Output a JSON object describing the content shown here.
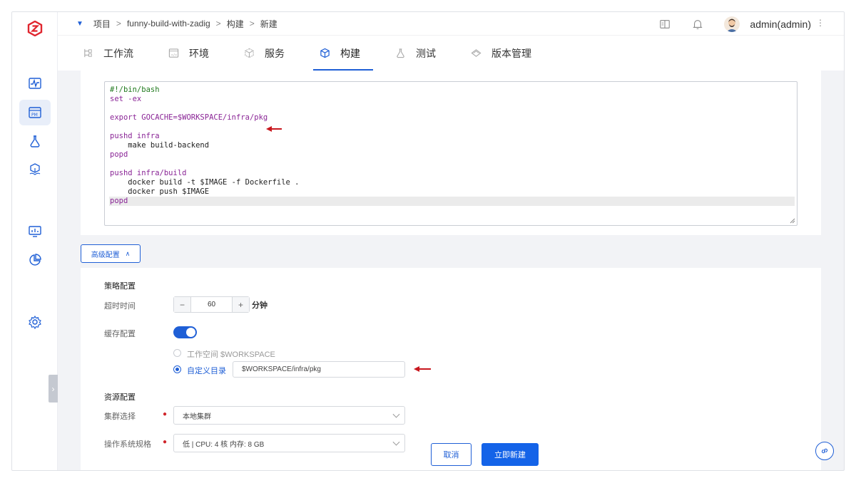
{
  "breadcrumb": {
    "items": [
      "项目",
      "funny-build-with-zadig",
      "构建",
      "新建"
    ],
    "separator": ">"
  },
  "user": {
    "name": "admin(admin)"
  },
  "tabs": [
    {
      "label": "工作流",
      "icon": "workflow-icon"
    },
    {
      "label": "环境",
      "icon": "environment-icon"
    },
    {
      "label": "服务",
      "icon": "service-icon"
    },
    {
      "label": "构建",
      "icon": "build-icon",
      "active": true
    },
    {
      "label": "测试",
      "icon": "test-icon"
    },
    {
      "label": "版本管理",
      "icon": "version-icon"
    }
  ],
  "script": {
    "lines": [
      {
        "text": "#!/bin/bash",
        "color": "#217a1f"
      },
      {
        "text": "set -ex",
        "color": "#8a2596"
      },
      {
        "text": "",
        "color": "#222222"
      },
      {
        "text": "export GOCACHE=$WORKSPACE/infra/pkg",
        "color": "#8a2596"
      },
      {
        "text": "",
        "color": "#222222"
      },
      {
        "text": "pushd infra",
        "color": "#8a2596"
      },
      {
        "text": "    make build-backend",
        "color": "#222222"
      },
      {
        "text": "popd",
        "color": "#8a2596"
      },
      {
        "text": "",
        "color": "#222222"
      },
      {
        "text": "pushd infra/build",
        "color": "#8a2596"
      },
      {
        "text": "    docker build -t $IMAGE -f Dockerfile .",
        "color": "#222222"
      },
      {
        "text": "    docker push $IMAGE",
        "color": "#222222"
      },
      {
        "text": "popd",
        "color": "#8a2596"
      }
    ]
  },
  "advanced": {
    "toggle_label": "高级配置"
  },
  "strategy": {
    "section_title": "策略配置",
    "timeout_label": "超时时间",
    "timeout_value": "60",
    "timeout_unit": "分钟",
    "cache_label": "缓存配置",
    "cache_enabled": true,
    "cache_option_workspace": "工作空间 $WORKSPACE",
    "cache_option_custom": "自定义目录",
    "cache_custom_path": "$WORKSPACE/infra/pkg"
  },
  "resources": {
    "section_title": "资源配置",
    "cluster_label": "集群选择",
    "cluster_value": "本地集群",
    "os_spec_label": "操作系统规格",
    "os_spec_value": "低 | CPU: 4 核 内存: 8 GB"
  },
  "footer": {
    "cancel_label": "取消",
    "create_label": "立即新建"
  },
  "colors": {
    "accent": "#1f5fd6",
    "annotation_arrow": "#c8171e"
  }
}
